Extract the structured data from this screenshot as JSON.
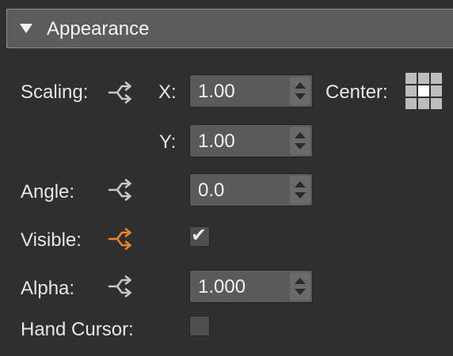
{
  "section": {
    "title": "Appearance",
    "expand_icon": "disclosure-triangle-down-icon"
  },
  "scaling": {
    "label": "Scaling:",
    "link_icon": "link-branch-icon",
    "x_label": "X:",
    "x_value": "1.00",
    "y_label": "Y:",
    "y_value": "1.00",
    "center_label": "Center:",
    "center_icon": "anchor-grid-icon"
  },
  "angle": {
    "label": "Angle:",
    "link_icon": "link-branch-icon",
    "value": "0.0"
  },
  "visible": {
    "label": "Visible:",
    "link_icon": "link-branch-icon",
    "link_color": "#e8842c",
    "checked": true,
    "check_glyph": "✔"
  },
  "alpha": {
    "label": "Alpha:",
    "link_icon": "link-branch-icon",
    "value": "1.000"
  },
  "hand_cursor": {
    "label": "Hand Cursor:",
    "checked": false
  },
  "colors": {
    "background": "#2f2f2f",
    "header": "#5c5c5c",
    "field": "#5a5a5a",
    "link_inactive": "#c8c8c8",
    "link_active": "#e8842c"
  }
}
